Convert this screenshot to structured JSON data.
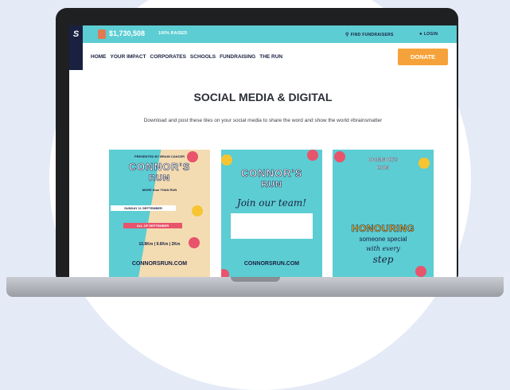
{
  "site": {
    "logo": "S",
    "raised_amount": "$1,730,508",
    "raised_label": "100% RAISED",
    "find_fundraisers": "FIND FUNDRAISERS",
    "login": "LOGIN",
    "donate_label": "DONATE"
  },
  "nav": {
    "items": [
      "HOME",
      "YOUR IMPACT",
      "CORPORATES",
      "SCHOOLS",
      "FUNDRAISING",
      "THE RUN"
    ]
  },
  "main": {
    "title": "SOCIAL MEDIA & DIGITAL",
    "subtitle": "Download and post these tiles on your social media to share the word and show the world #brainsmatter"
  },
  "tiles": [
    {
      "top_note": "PRESENTED BY BRAIN CANCER",
      "title_line1": "CONNOR'S",
      "title_line2": "RUN",
      "tagline": "MORE than THAN RUN",
      "date1": "SUNDAY 11 SEPTEMBER",
      "date2": "ALL OF SEPTEMBER",
      "distances": "10.8Km | 9.6Km | 2Km",
      "url": "CONNORSRUN.COM"
    },
    {
      "title_line1": "CONNOR'S",
      "title_line2": "RUN",
      "script": "Join our team!",
      "url": "CONNORSRUN.COM"
    },
    {
      "title_line1": "CONNOR'S",
      "title_line2": "RUN",
      "headline": "HONOURING",
      "line2": "someone special",
      "line3": "with every",
      "line4": "step"
    }
  ],
  "colors": {
    "teal": "#5ccdd3",
    "navy": "#1a2040",
    "orange": "#f6a23a"
  }
}
